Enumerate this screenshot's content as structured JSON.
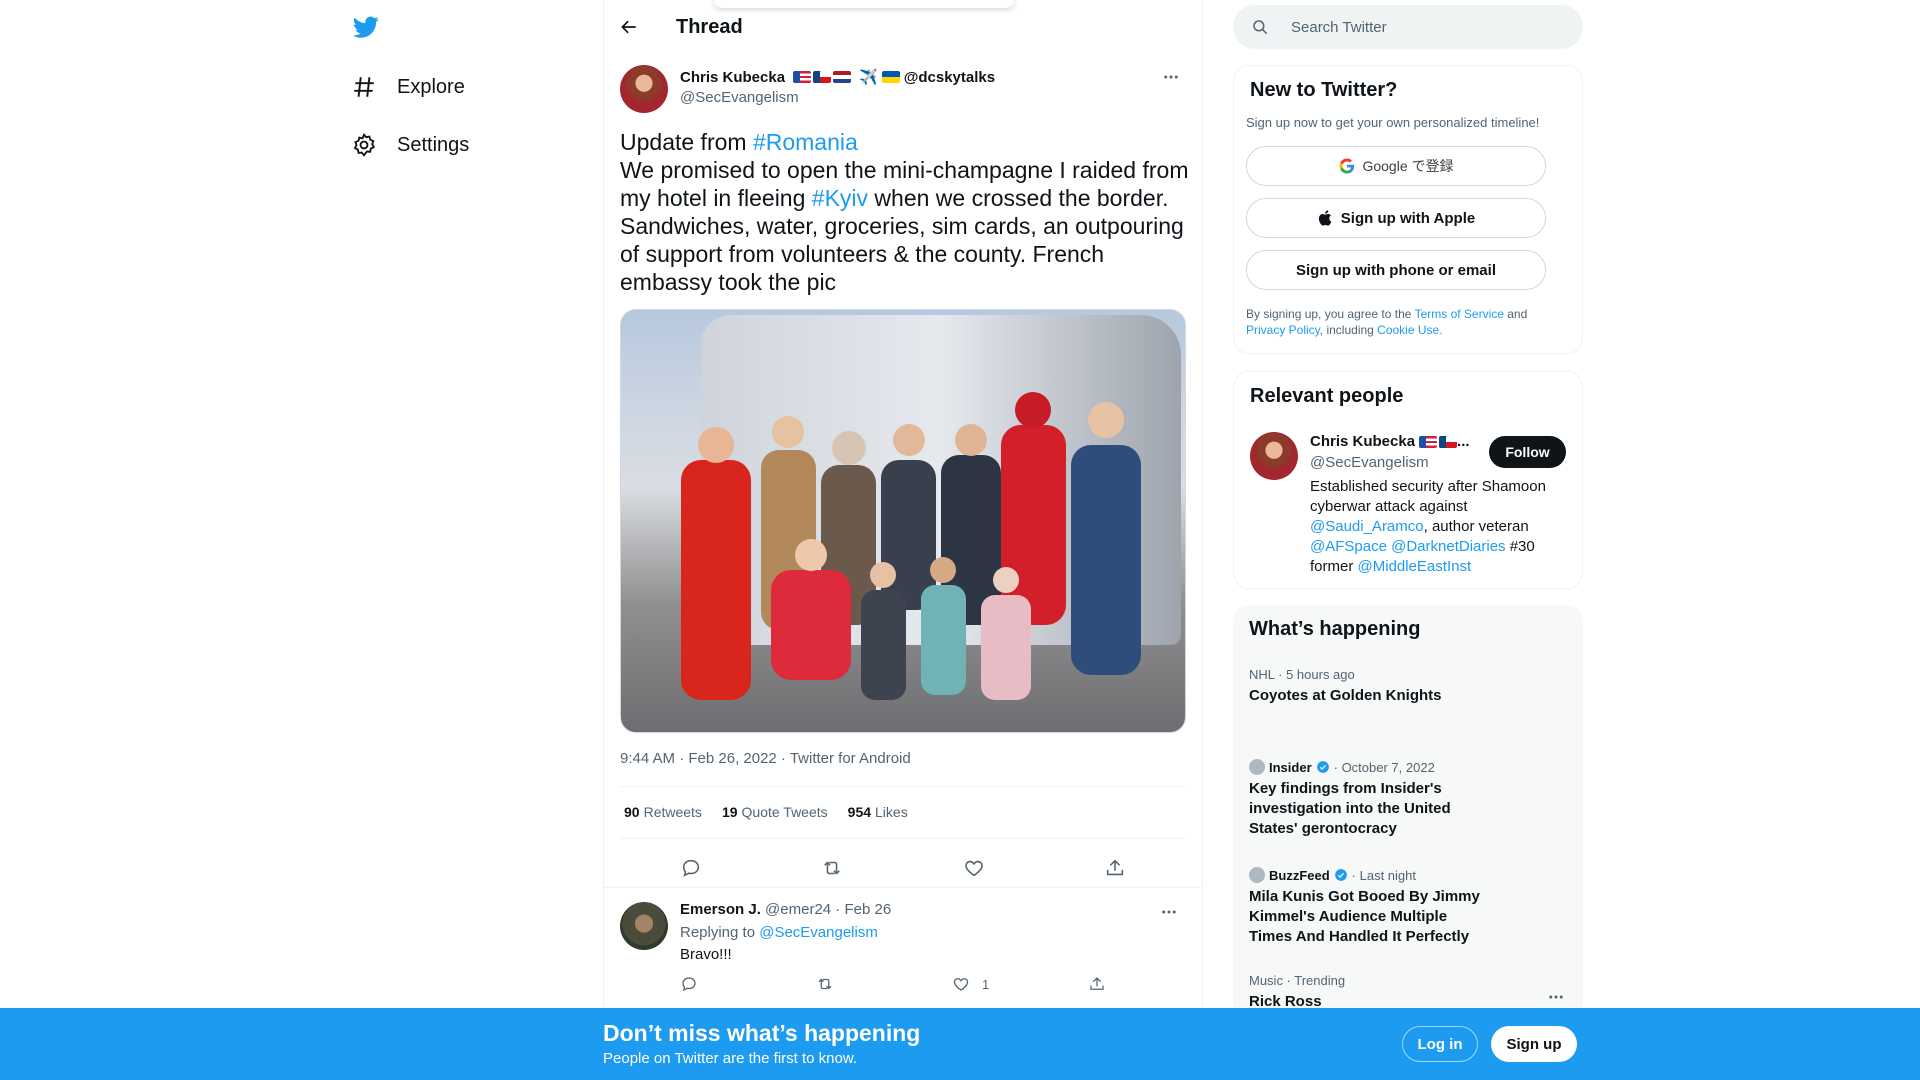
{
  "nav": {
    "explore_label": "Explore",
    "settings_label": "Settings"
  },
  "header": {
    "title": "Thread"
  },
  "tweet": {
    "author_name": "Chris Kubecka",
    "author_name_suffix": "✈️",
    "author_extra": "@dcskytalks",
    "author_handle": "@SecEvangelism",
    "text_part1": "Update from ",
    "hashtag1": "#Romania",
    "text_part2": "We promised to open the mini-champagne I raided from my hotel in fleeing ",
    "hashtag2": "#Kyiv",
    "text_part3": " when we crossed the border. Sandwiches, water, groceries, sim cards, an outpouring of support from volunteers & the county. French embassy took the pic",
    "meta": "9:44 AM · Feb 26, 2022 · Twitter for Android",
    "retweets_count": "90",
    "retweets_label": "Retweets",
    "quotes_count": "19",
    "quotes_label": "Quote Tweets",
    "likes_count": "954",
    "likes_label": "Likes"
  },
  "reply": {
    "name": "Emerson J.",
    "handle_date": "@emer24 · Feb 26",
    "replying_prefix": "Replying to ",
    "replying_to": "@SecEvangelism",
    "text": "Bravo!!!",
    "like_count": "1"
  },
  "search": {
    "placeholder": "Search Twitter"
  },
  "new_to_twitter": {
    "title": "New to Twitter?",
    "subtitle": "Sign up now to get your own personalized timeline!",
    "google_label": "Google で登録",
    "apple_label": "Sign up with Apple",
    "phone_label": "Sign up with phone or email",
    "terms_prefix": "By signing up, you agree to the ",
    "terms_link": "Terms of Service",
    "terms_and": " and ",
    "privacy_link": "Privacy Policy",
    "terms_including": ", including ",
    "cookie_link": "Cookie Use."
  },
  "relevant_people": {
    "title": "Relevant people",
    "name": "Chris Kubecka",
    "name_ellipsis": "...",
    "handle": "@SecEvangelism",
    "follow_label": "Follow",
    "bio_part1": "Established security after Shamoon cyberwar attack against ",
    "bio_link1": "@Saudi_Aramco",
    "bio_part2": ", author veteran ",
    "bio_link2": "@AFSpace",
    "bio_link3": "@DarknetDiaries",
    "bio_part3": " #30 former ",
    "bio_link4": "@MiddleEastInst"
  },
  "happening": {
    "title": "What’s happening",
    "trends": [
      {
        "meta": "NHL · 5 hours ago",
        "title": "Coyotes at Golden Knights"
      },
      {
        "source": "Insider",
        "date": "· October 7, 2022",
        "title": "Key findings from Insider's investigation into the United States' gerontocracy"
      },
      {
        "source": "BuzzFeed",
        "date": "· Last night",
        "title": "Mila Kunis Got Booed By Jimmy Kimmel's Audience Multiple Times And Handled It Perfectly"
      },
      {
        "meta": "Music · Trending",
        "title": "Rick Ross"
      }
    ]
  },
  "banner": {
    "title": "Don’t miss what’s happening",
    "subtitle": "People on Twitter are the first to know.",
    "login_label": "Log in",
    "signup_label": "Sign up"
  },
  "colors": {
    "brand": "#1d9bf0",
    "text": "#0f1419",
    "muted": "#536471"
  }
}
